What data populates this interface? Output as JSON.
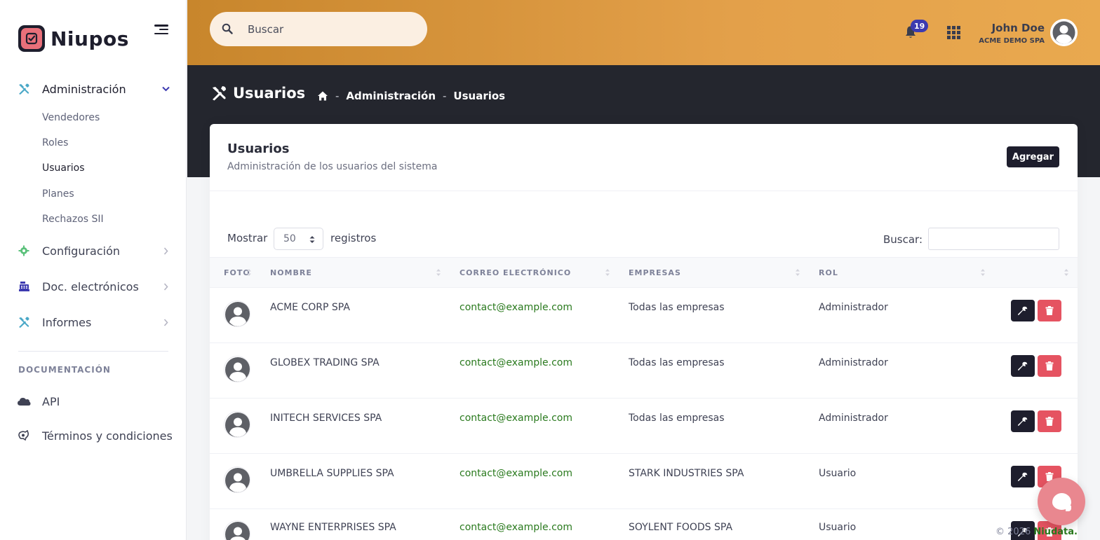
{
  "brand": {
    "name": "Niupos"
  },
  "sidebar": {
    "admin": {
      "label": "Administración",
      "children": [
        "Vendedores",
        "Roles",
        "Usuarios",
        "Planes",
        "Rechazos SII"
      ]
    },
    "items": [
      {
        "label": "Configuración",
        "icon": "gear-icon"
      },
      {
        "label": "Doc. electrónicos",
        "icon": "cash-register-icon"
      },
      {
        "label": "Informes",
        "icon": "tools-icon"
      }
    ],
    "section_title": "DOCUMENTACIÓN",
    "doc_items": [
      {
        "label": "API",
        "icon": "cloud-icon"
      },
      {
        "label": "Términos y condiciones",
        "icon": "shield-icon"
      }
    ],
    "active_child": "Usuarios",
    "accent_color": "#4aa8c7"
  },
  "header": {
    "search_placeholder": "Buscar",
    "notifications_count": "19",
    "user_name": "John Doe",
    "user_company": "ACME DEMO SPA",
    "gradient_from": "#c8862c",
    "gradient_to": "#e9a94f"
  },
  "page": {
    "title": "Usuarios",
    "breadcrumb": [
      "Administración",
      "Usuarios"
    ]
  },
  "card": {
    "title": "Usuarios",
    "subtitle": "Administración de los usuarios del sistema",
    "add_label": "Agregar",
    "length_label": "Mostrar",
    "length_value": "50",
    "length_suffix": "registros",
    "filter_label": "Buscar:",
    "filter_value": ""
  },
  "table": {
    "columns": [
      "FOTO",
      "NOMBRE",
      "CORREO ELECTRÓNICO",
      "EMPRESAS",
      "ROL"
    ],
    "rows": [
      {
        "name": "ACME CORP SPA",
        "email": "contact@example.com",
        "company": "Todas las empresas",
        "role": "Administrador"
      },
      {
        "name": "GLOBEX TRADING SPA",
        "email": "contact@example.com",
        "company": "Todas las empresas",
        "role": "Administrador"
      },
      {
        "name": "INITECH SERVICES SPA",
        "email": "contact@example.com",
        "company": "Todas las empresas",
        "role": "Administrador"
      },
      {
        "name": "UMBRELLA SUPPLIES SPA",
        "email": "contact@example.com",
        "company": "STARK INDUSTRIES SPA",
        "role": "Usuario"
      },
      {
        "name": "WAYNE ENTERPRISES SPA",
        "email": "contact@example.com",
        "company": "SOYLENT FOODS SPA",
        "role": "Usuario"
      }
    ]
  },
  "footer": {
    "copyright": "© 2026",
    "brand": "Niudata."
  }
}
